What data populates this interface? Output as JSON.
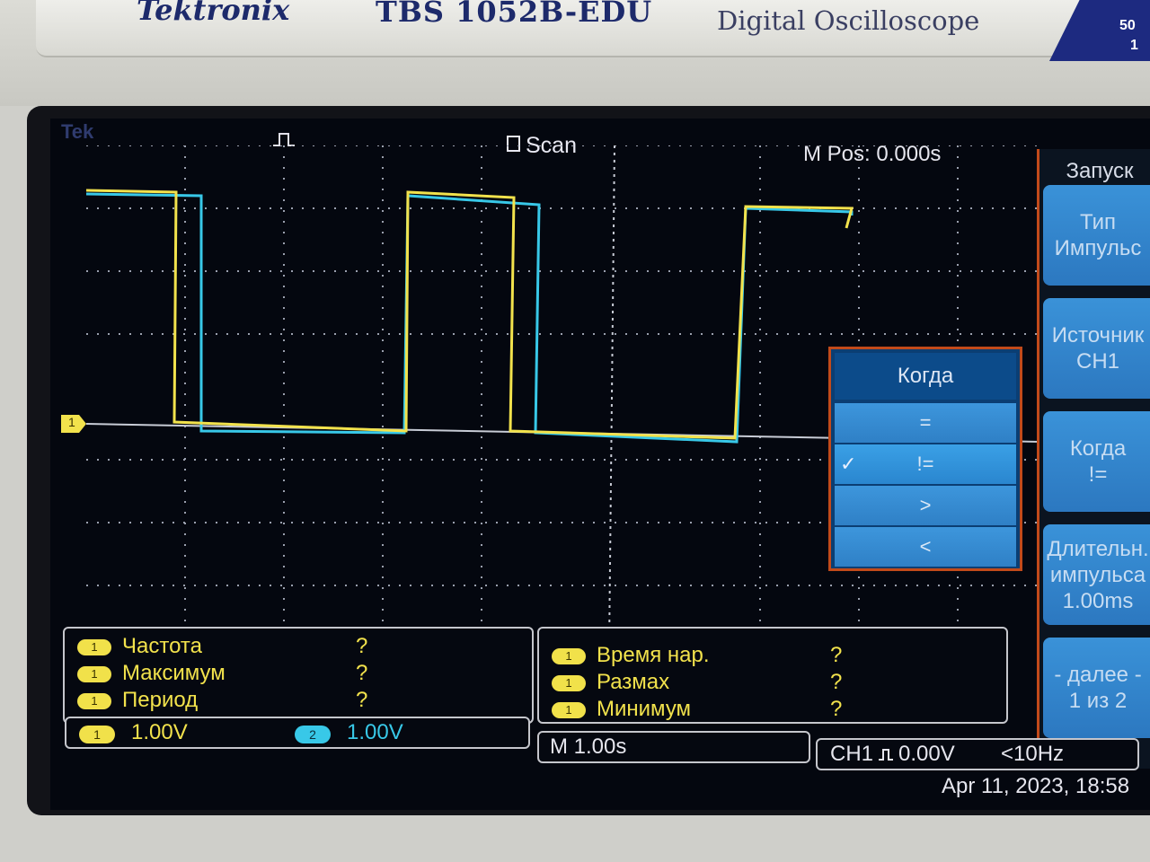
{
  "bezel": {
    "brand": "Tektronix",
    "model": "TBS 1052B-EDU",
    "description": "Digital Oscilloscope",
    "badge_line1": "50",
    "badge_line2": "1"
  },
  "status": {
    "logo": "Tek",
    "trigger_icon": "pulse-trigger-icon",
    "acq_mode": "Scan",
    "mpos": "M Pos: 0.000s"
  },
  "menu": {
    "title": "Запуск",
    "softkeys": [
      {
        "line1": "Тип",
        "line2": "Импульс"
      },
      {
        "line1": "Источник",
        "line2": "CH1"
      },
      {
        "line1": "Когда",
        "line2": "!="
      },
      {
        "line1": "Длительн.",
        "line2": "импульса",
        "line3": "1.00ms"
      },
      {
        "line1": "- далее -",
        "line2": "1 из 2"
      }
    ]
  },
  "popup": {
    "title": "Когда",
    "options": [
      "=",
      "!=",
      ">",
      "<"
    ],
    "selected_index": 1,
    "check": "✓"
  },
  "measurements": {
    "left": [
      {
        "ch": "1",
        "label": "Частота",
        "value": "?"
      },
      {
        "ch": "1",
        "label": "Максимум",
        "value": "?"
      },
      {
        "ch": "1",
        "label": "Период",
        "value": "?"
      }
    ],
    "right": [
      {
        "ch": "1",
        "label": "Время нар.",
        "value": "?"
      },
      {
        "ch": "1",
        "label": "Размах",
        "value": "?"
      },
      {
        "ch": "1",
        "label": "Минимум",
        "value": "?"
      }
    ]
  },
  "bottom": {
    "ch1_chip": "1",
    "ch1_scale": "1.00V",
    "ch2_chip": "2",
    "ch2_scale": "1.00V",
    "timebase": "M 1.00s",
    "trigger_source": "CH1",
    "trigger_icon": "rising-pulse-icon",
    "trigger_level": "0.00V",
    "frequency": "<10Hz",
    "date": "Apr 11, 2023, 18:58"
  },
  "ground_marker": "1",
  "colors": {
    "ch1": "#f2e24c",
    "ch2": "#38c8e8",
    "softkey": "#2f80c6",
    "menu_border": "#c24a1a",
    "screen_bg": "#04070f"
  }
}
